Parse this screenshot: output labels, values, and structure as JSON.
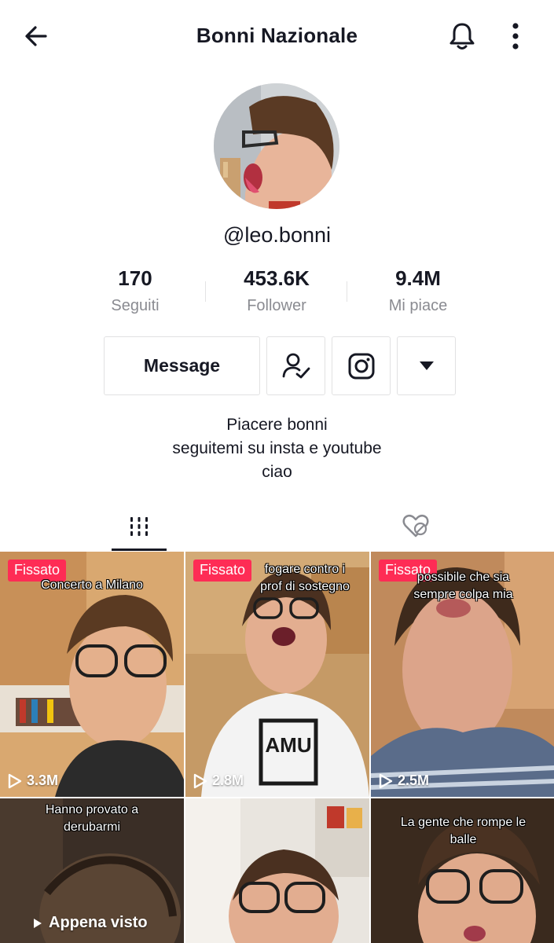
{
  "header": {
    "title": "Bonni Nazionale",
    "back_icon": "arrow-left-icon",
    "bell_icon": "bell-icon",
    "more_icon": "more-vertical-icon"
  },
  "profile": {
    "username": "@leo.bonni",
    "stats": [
      {
        "value": "170",
        "label": "Seguiti"
      },
      {
        "value": "453.6K",
        "label": "Follower"
      },
      {
        "value": "9.4M",
        "label": "Mi piace"
      }
    ],
    "actions": {
      "message_label": "Message",
      "following_icon": "user-check-icon",
      "instagram_icon": "instagram-icon",
      "dropdown_icon": "caret-down-icon"
    },
    "bio": [
      "Piacere bonni",
      "seguitemi su insta e youtube",
      "ciao"
    ]
  },
  "tabs": [
    {
      "name": "videos",
      "icon": "grid-icon",
      "active": true
    },
    {
      "name": "liked",
      "icon": "hidden-heart-icon",
      "active": false
    }
  ],
  "videos": [
    {
      "pinned_label": "Fissato",
      "caption": "Concerto a Milano",
      "views": "3.3M"
    },
    {
      "pinned_label": "Fissato",
      "caption": "fogare contro i\nprof di sostegno",
      "views": "2.8M"
    },
    {
      "pinned_label": "Fissato",
      "caption": "possibile che sia\nsempre colpa mia",
      "views": "2.5M"
    },
    {
      "caption": "Hanno provato a\nderubarmi",
      "seen_label": "Appena visto"
    },
    {
      "caption": ""
    },
    {
      "caption": "La gente che rompe le\nballe"
    }
  ],
  "colors": {
    "accent": "#fe2c55",
    "text": "#161823",
    "muted": "#8a8b91",
    "border": "#e1e1e2"
  }
}
